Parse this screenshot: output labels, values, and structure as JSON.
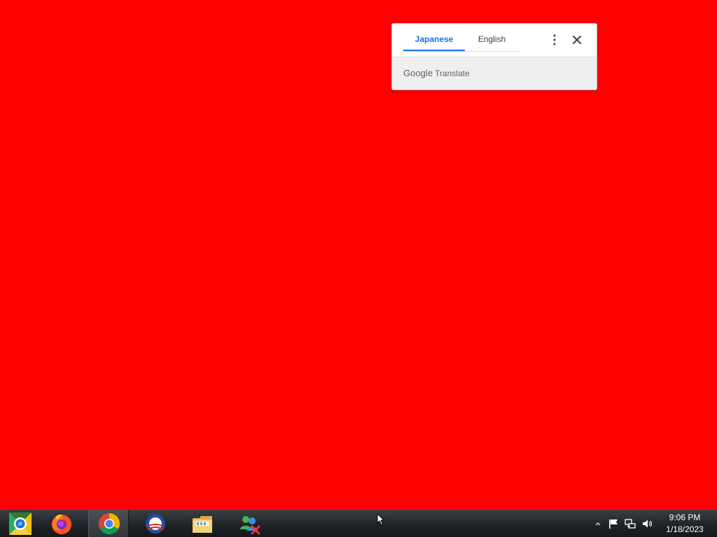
{
  "desktop": {
    "background_color": "#ff0000"
  },
  "translate_popup": {
    "tabs": [
      {
        "label": "Japanese",
        "selected": true
      },
      {
        "label": "English",
        "selected": false
      }
    ],
    "menu_icon": "more-vertical-icon",
    "close_icon": "close-icon",
    "brand": {
      "google": "Google",
      "product": "Translate"
    },
    "accent_color": "#1a73e8"
  },
  "taskbar": {
    "apps": [
      {
        "name": "Chromium",
        "icon": "chromium-icon",
        "active": false
      },
      {
        "name": "Firefox",
        "icon": "firefox-icon",
        "active": false
      },
      {
        "name": "Google Chrome",
        "icon": "chrome-icon",
        "active": true
      },
      {
        "name": "Obama Campaign",
        "icon": "obama-logo-icon",
        "active": false
      },
      {
        "name": "File Explorer",
        "icon": "folder-icon",
        "active": false
      },
      {
        "name": "Messenger",
        "icon": "messenger-icon",
        "active": false
      }
    ],
    "tray": {
      "icons": [
        "show-hidden-icons-icon",
        "action-center-flag-icon",
        "network-icon",
        "volume-icon"
      ]
    },
    "clock": {
      "time": "9:06 PM",
      "date": "1/18/2023"
    }
  }
}
